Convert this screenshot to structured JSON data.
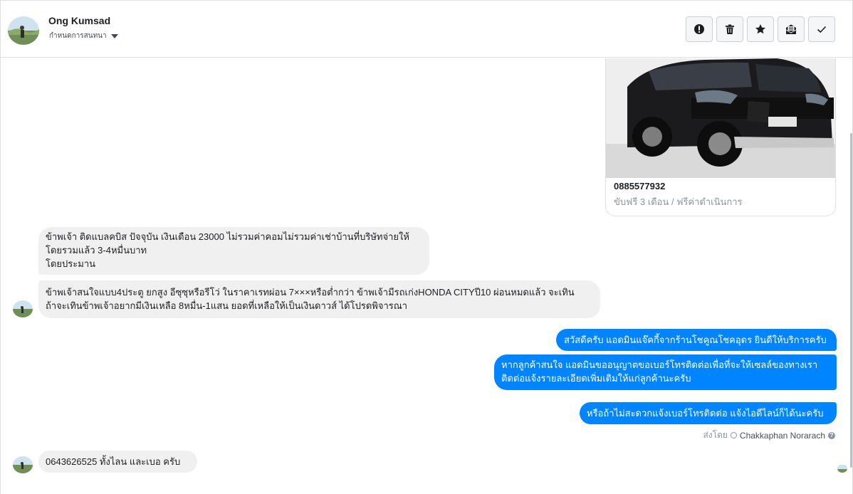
{
  "header": {
    "contact_name": "Ong Kumsad",
    "assign_label": "กำหนดการสนทนา"
  },
  "toolbar": {
    "buttons": [
      {
        "icon": "exclamation-icon",
        "name": "spam-button"
      },
      {
        "icon": "trash-icon",
        "name": "delete-button"
      },
      {
        "icon": "star-icon",
        "name": "star-button"
      },
      {
        "icon": "mark-unread-icon",
        "name": "mark-unread-button"
      },
      {
        "icon": "check-icon",
        "name": "mark-done-button"
      }
    ]
  },
  "card": {
    "title": "0885577932",
    "subtitle": "ขับฟรี 3 เดือน / ฟรีค่าดำเนินการ"
  },
  "messages": {
    "m1": {
      "direction": "incoming",
      "lines": [
        "ข้าพเจ้า ติดแบลคบิส ปัจจุบัน เงินเดือน 23000 ไม่รวมค่าคอมไม่รวมค่าเช่าบ้านที่บริษัทจ่ายให้",
        "โดยรวมแล้ว 3-4หมื่นบาท",
        "โดยประมาน"
      ]
    },
    "m2": {
      "direction": "incoming",
      "lines": [
        "ข้าพเจ้าสนใจแบบ4ประตู ยกสูง อีซุซุหรือรีโว่ ในราคาเรทผ่อน 7×××หรือต่ำกว่า ข้าพเจ้ามีรถเก่งHONDA CITYปี10 ผ่อนหมดแล้ว จะเทิน",
        "ถ้าจะเทินข้าพเจ้าอยากมีเงินเหลือ 8หมื่น-1แสน ยอดที่เหลือให้เป็นเงินดาวส์ ได้โปรดพิจารณา"
      ]
    },
    "m3": {
      "direction": "outgoing",
      "lines": [
        "สวัสดีครับ แอดมินแจ๊คกี้จากร้านโชคูณโชคอุดร ยินดีให้บริการครับ"
      ]
    },
    "m4": {
      "direction": "outgoing",
      "lines": [
        "หากลูกค้าสนใจ แอดมินขออนุญาตขอเบอร์โทรติดต่อเพื่อที่จะให้เซลล์ของทางเรา",
        "ติดต่อแจ้งรายละเอียดเพิ่มเติมให้แก่ลูกค้านะครับ"
      ]
    },
    "m5": {
      "direction": "outgoing",
      "lines": [
        "หรือถ้าไม่สะดวกแจ้งเบอร์โทรติดต่อ แจ้งไอดีไลน์ก็ได้นะครับ"
      ]
    },
    "m6": {
      "direction": "incoming",
      "lines": [
        "0643626525 ทั้งไลน และเบอ ครับ"
      ]
    }
  },
  "sent_by": {
    "prefix": "ส่งโดย",
    "name": "Chakkaphan Norarach",
    "help": "?"
  },
  "colors": {
    "outgoing_bubble": "#0084ff",
    "incoming_bubble": "#f1f0f0",
    "divider": "#dddfe2"
  }
}
